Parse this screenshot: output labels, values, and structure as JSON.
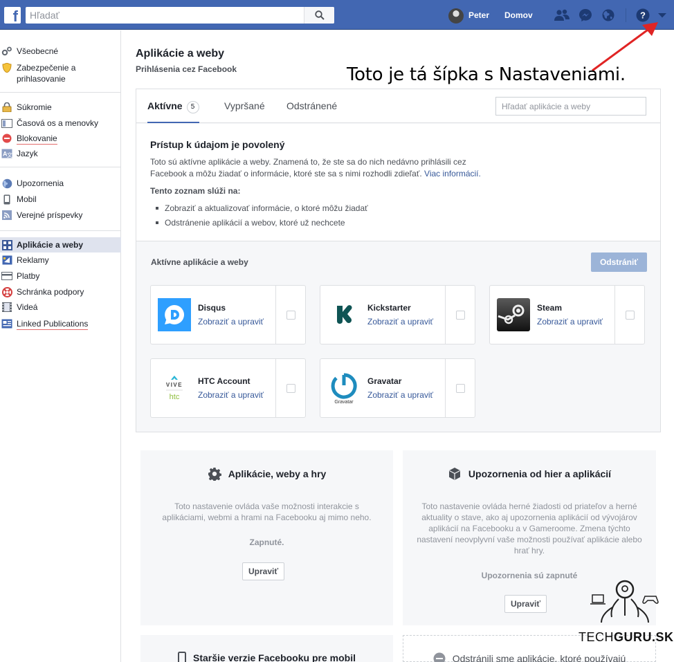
{
  "topbar": {
    "search_placeholder": "Hľadať",
    "user_name": "Peter",
    "home_label": "Domov"
  },
  "sidebar": {
    "groups": [
      [
        {
          "label": "Všeobecné",
          "icon": "gears-icon"
        },
        {
          "label": "Zabezpečenie a prihlasovanie",
          "icon": "shield-icon"
        }
      ],
      [
        {
          "label": "Súkromie",
          "icon": "lock-icon"
        },
        {
          "label": "Časová os a menovky",
          "icon": "timeline-icon"
        },
        {
          "label": "Blokovanie",
          "icon": "block-icon"
        },
        {
          "label": "Jazyk",
          "icon": "language-icon"
        }
      ],
      [
        {
          "label": "Upozornenia",
          "icon": "globe-icon"
        },
        {
          "label": "Mobil",
          "icon": "mobile-icon"
        },
        {
          "label": "Verejné príspevky",
          "icon": "rss-icon"
        }
      ],
      [
        {
          "label": "Aplikácie a weby",
          "icon": "apps-icon"
        },
        {
          "label": "Reklamy",
          "icon": "ads-icon"
        },
        {
          "label": "Platby",
          "icon": "card-icon"
        },
        {
          "label": "Schránka podpory",
          "icon": "lifebuoy-icon"
        },
        {
          "label": "Videá",
          "icon": "film-icon"
        },
        {
          "label": "Linked Publications",
          "icon": "publication-icon"
        }
      ]
    ]
  },
  "main": {
    "title": "Aplikácie a weby",
    "subtitle": "Prihlásenia cez Facebook",
    "annotation": "Toto je tá šípka s Nastaveniami."
  },
  "tabs": {
    "active_label": "Aktívne",
    "active_count": "5",
    "expired_label": "Vypršané",
    "removed_label": "Odstránené",
    "search_placeholder": "Hľadať aplikácie a weby"
  },
  "info": {
    "title": "Prístup k údajom je povolený",
    "text": "Toto sú aktívne aplikácie a weby. Znamená to, že ste sa do nich nedávno prihlásili cez Facebook a môžu žiadať o informácie, ktoré ste sa s nimi rozhodli zdieľať.",
    "more_link": "Viac informácií.",
    "list_title": "Tento zoznam slúži na:",
    "list": [
      "Zobraziť a aktualizovať informácie, o ktoré môžu žiadať",
      "Odstránenie aplikácií a webov, ktoré už nechcete"
    ]
  },
  "apps": {
    "section_label": "Aktívne aplikácie a weby",
    "remove_label": "Odstrániť",
    "edit_label": "Zobraziť a upraviť",
    "items": [
      {
        "name": "Disqus"
      },
      {
        "name": "Kickstarter"
      },
      {
        "name": "Steam"
      },
      {
        "name": "HTC Account"
      },
      {
        "name": "Gravatar"
      }
    ]
  },
  "settings": {
    "apps_games": {
      "title": "Aplikácie, weby a hry",
      "desc": "Toto nastavenie ovláda vaše možnosti interakcie s aplikáciami, webmi a hrami na Facebooku aj mimo neho.",
      "status": "Zapnuté.",
      "button": "Upraviť"
    },
    "game_notifications": {
      "title": "Upozornenia od hier a aplikácií",
      "desc": "Toto nastavenie ovláda herné žiadosti od priateľov a herné aktuality o stave, ako aj upozornenia aplikácií od vývojárov aplikácií na Facebooku a v Gameroome. Zmena týchto nastavení neovplyvní vaše možnosti používať aplikácie alebo hrať hry.",
      "status": "Upozornenia sú zapnuté",
      "button": "Upraviť"
    },
    "old_mobile": {
      "title": "Staršie verzie Facebooku pre mobil"
    },
    "removed_apps": {
      "title": "Odstránili sme aplikácie, ktoré používajú"
    }
  },
  "watermark": {
    "part1": "TECH",
    "part2": "GURU",
    "part3": ".SK"
  },
  "colors": {
    "brand": "#4267b2",
    "link": "#365899",
    "annotation_arrow": "#e02424"
  }
}
